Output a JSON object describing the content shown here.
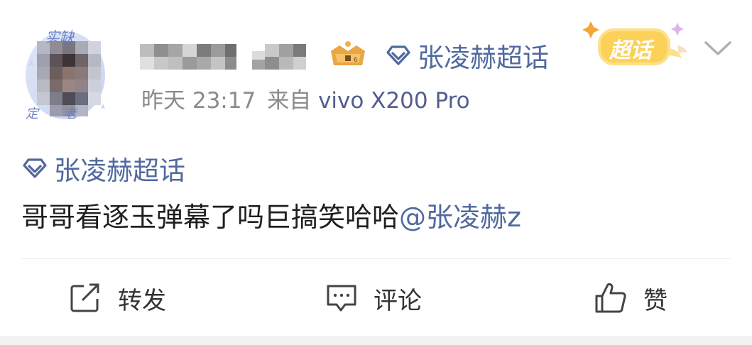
{
  "post": {
    "topic": "张凌赫超话",
    "supertopic_badge": "超话",
    "time": "昨天 23:17",
    "source_prefix": "来自",
    "device": "vivo X200 Pro",
    "body_topic": "张凌赫超话",
    "text": "哥哥看逐玉弹幕了吗巨搞笑哈哈",
    "mention": "@张凌赫z"
  },
  "actions": {
    "repost": "转发",
    "comment": "评论",
    "like": "赞"
  },
  "avatar_frame": {
    "top_text": "实缺",
    "bottom_text_left": "定",
    "bottom_text_right": "老"
  },
  "colors": {
    "link": "#50699f",
    "meta": "#8a8a8a",
    "badge": "#f6b73c"
  }
}
